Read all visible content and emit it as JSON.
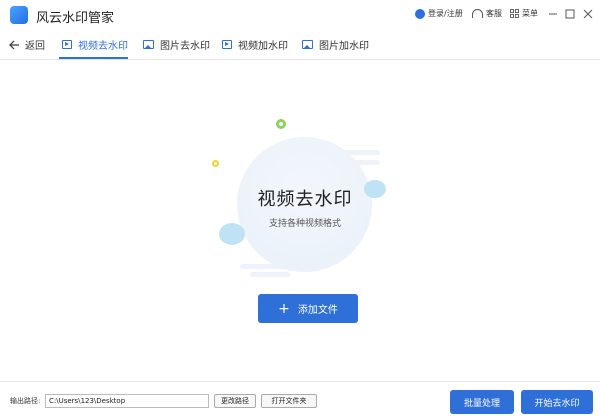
{
  "app": {
    "title": "风云水印管家"
  },
  "titlebar": {
    "login_label": "登录/注册",
    "service_label": "客服",
    "menu_label": "菜单"
  },
  "nav": {
    "back_label": "返回",
    "tabs": [
      {
        "label": "视频去水印",
        "active": true,
        "icon": "video-icon"
      },
      {
        "label": "图片去水印",
        "active": false,
        "icon": "image-icon"
      },
      {
        "label": "视频加水印",
        "active": false,
        "icon": "video-icon"
      },
      {
        "label": "图片加水印",
        "active": false,
        "icon": "image-icon"
      }
    ]
  },
  "main": {
    "title": "视频去水印",
    "subtitle": "支持各种视频格式",
    "add_button_label": "添加文件"
  },
  "bottom": {
    "output_label": "输出路径:",
    "output_path": "C:\\Users\\123\\Desktop",
    "change_path_label": "更改路径",
    "open_folder_label": "打开文件夹",
    "batch_label": "批量处理",
    "start_label": "开始去水印"
  },
  "colors": {
    "accent": "#2f6fd8",
    "bubble": "#bfe3f5",
    "ring_green": "#8bd35a",
    "ring_yellow": "#f1d236"
  }
}
